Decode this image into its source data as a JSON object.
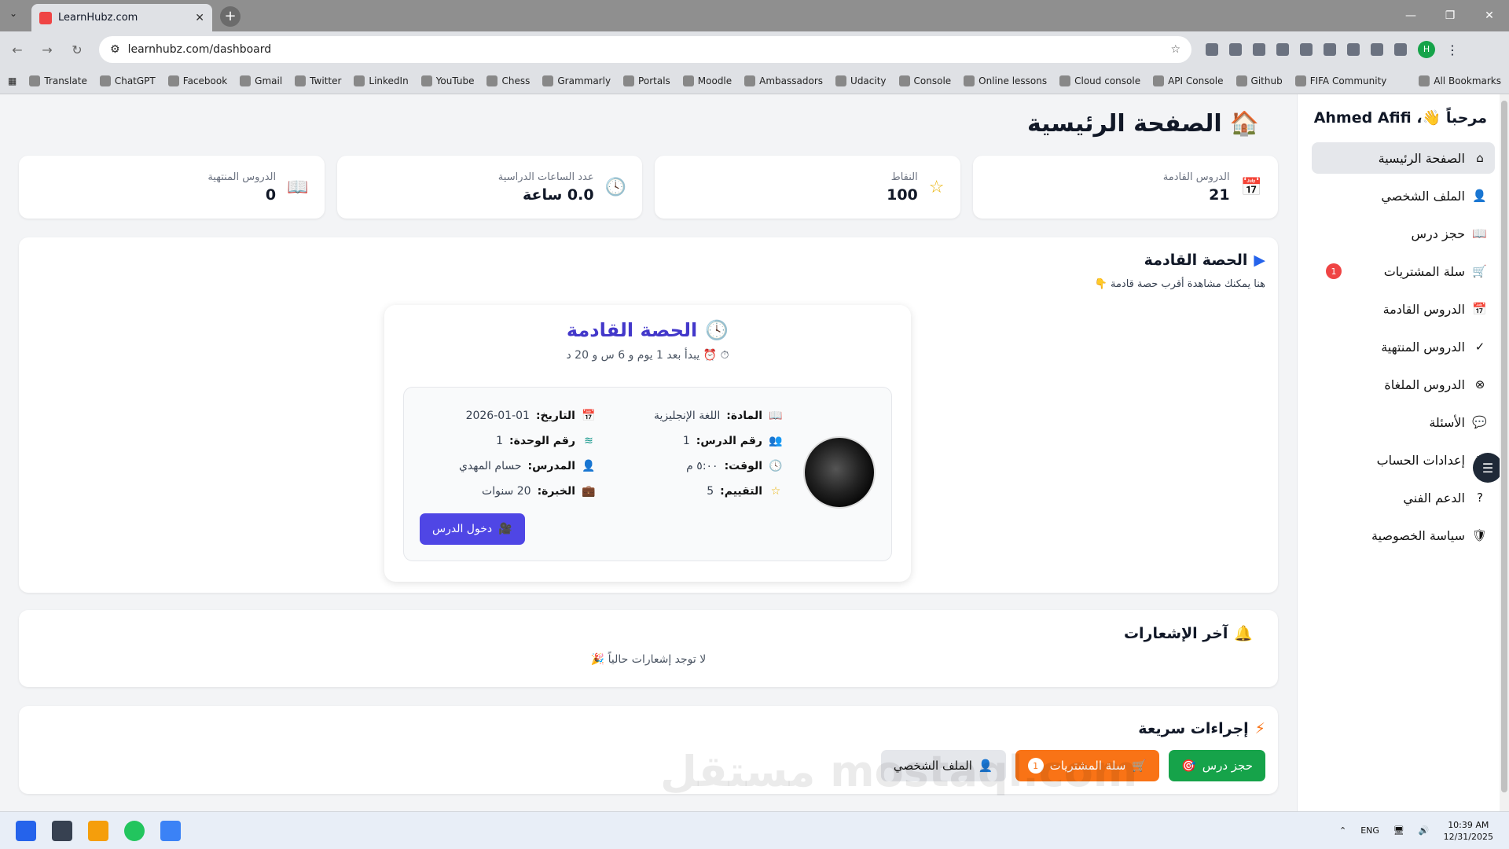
{
  "browser": {
    "tab_title": "LearnHubz.com",
    "url": "learnhubz.com/dashboard",
    "bookmarks": [
      "Translate",
      "ChatGPT",
      "Facebook",
      "Gmail",
      "Twitter",
      "LinkedIn",
      "YouTube",
      "Chess",
      "Grammarly",
      "Portals",
      "Moodle",
      "Ambassadors",
      "Udacity",
      "Console",
      "Online lessons",
      "Cloud console",
      "API Console",
      "Github",
      "FIFA Community"
    ],
    "all_bookmarks": "All Bookmarks",
    "profile_initial": "H"
  },
  "sidebar": {
    "greeting": "مرحباً 👋، Ahmed Afifi",
    "items": [
      {
        "label": "الصفحة الرئيسية",
        "icon": "⌂"
      },
      {
        "label": "الملف الشخصي",
        "icon": "👤"
      },
      {
        "label": "حجز درس",
        "icon": "📖"
      },
      {
        "label": "سلة المشتريات",
        "icon": "🛒",
        "badge": "1"
      },
      {
        "label": "الدروس القادمة",
        "icon": "📅"
      },
      {
        "label": "الدروس المنتهية",
        "icon": "✓"
      },
      {
        "label": "الدروس الملغاة",
        "icon": "⊗"
      },
      {
        "label": "الأسئلة",
        "icon": "💬"
      },
      {
        "label": "إعدادات الحساب",
        "icon": "⚙"
      },
      {
        "label": "الدعم الفني",
        "icon": "?"
      },
      {
        "label": "سياسة الخصوصية",
        "icon": "🛡"
      }
    ]
  },
  "page": {
    "title": "الصفحة الرئيسية",
    "title_icon": "🏠"
  },
  "stats": [
    {
      "label": "الدروس القادمة",
      "value": "21",
      "icon": "📅",
      "color": "#2563eb"
    },
    {
      "label": "النقاط",
      "value": "100",
      "icon": "☆",
      "color": "#eab308"
    },
    {
      "label": "عدد الساعات الدراسية",
      "value": "0.0 ساعة",
      "icon": "🕓",
      "color": "#2563eb"
    },
    {
      "label": "الدروس المنتهية",
      "value": "0",
      "icon": "📖",
      "color": "#9333ea"
    }
  ],
  "next_lesson": {
    "section_title": "الحصة القادمة",
    "subtitle": "هنا يمكنك مشاهدة أقرب حصة قادمة 👇",
    "card_title": "الحصة القادمة",
    "countdown": "يبدأ بعد 1 يوم و 6 س و 20 د",
    "subject_label": "المادة:",
    "subject": "اللغة الإنجليزية",
    "lesson_no_label": "رقم الدرس:",
    "lesson_no": "1",
    "time_label": "الوقت:",
    "time": "٥:٠٠ م",
    "rating_label": "التقييم:",
    "rating": "5",
    "date_label": "التاريخ:",
    "date": "2026-01-01",
    "unit_label": "رقم الوحدة:",
    "unit": "1",
    "teacher_label": "المدرس:",
    "teacher": "حسام المهدي",
    "experience_label": "الخبرة:",
    "experience": "20 سنوات",
    "enter_button": "دخول الدرس"
  },
  "notifications": {
    "title": "آخر الإشعارات",
    "empty": "لا توجد إشعارات حالياً 🎉"
  },
  "quick_actions": {
    "title": "إجراءات سريعة",
    "book": "حجز درس",
    "cart": "سلة المشتريات",
    "cart_count": "1",
    "profile": "الملف الشخصي"
  },
  "watermark": "مستقل mostaql.com",
  "taskbar": {
    "lang": "ENG",
    "time": "10:39 AM",
    "date": "12/31/2025"
  }
}
